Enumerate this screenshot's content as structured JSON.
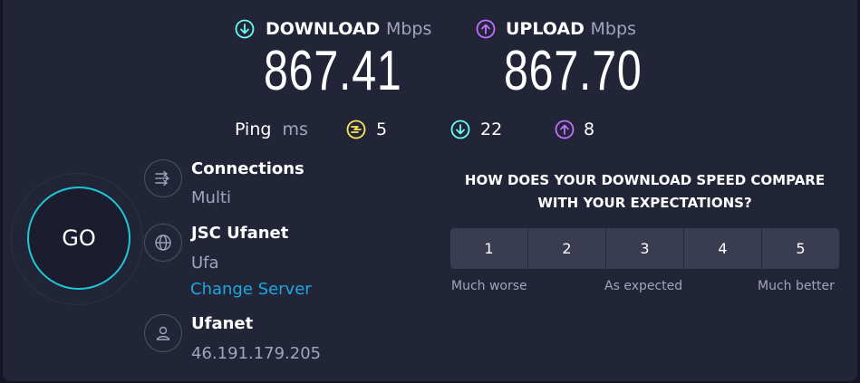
{
  "colors": {
    "download": "#6afff3",
    "upload": "#bf71ff",
    "jitter": "#fbe75b",
    "accent": "#1ca8dd",
    "go_ring": "#1fc7d4"
  },
  "download": {
    "label": "DOWNLOAD",
    "unit": "Mbps",
    "value": "867.41",
    "icon": "download-arrow-icon"
  },
  "upload": {
    "label": "UPLOAD",
    "unit": "Mbps",
    "value": "867.70",
    "icon": "upload-arrow-icon"
  },
  "ping": {
    "label": "Ping",
    "unit": "ms",
    "jitter": "5",
    "download_latency": "22",
    "upload_latency": "8"
  },
  "go_button": {
    "label": "GO"
  },
  "connections": {
    "title": "Connections",
    "value": "Multi",
    "icon": "connections-icon"
  },
  "server": {
    "name": "JSC Ufanet",
    "location": "Ufa",
    "change_link": "Change Server",
    "icon": "globe-icon"
  },
  "provider": {
    "name": "Ufanet",
    "ip": "46.191.179.205",
    "icon": "user-icon"
  },
  "survey": {
    "question": "HOW DOES YOUR DOWNLOAD SPEED COMPARE WITH YOUR EXPECTATIONS?",
    "options": [
      "1",
      "2",
      "3",
      "4",
      "5"
    ],
    "scale": {
      "low": "Much worse",
      "mid": "As expected",
      "high": "Much better"
    }
  }
}
